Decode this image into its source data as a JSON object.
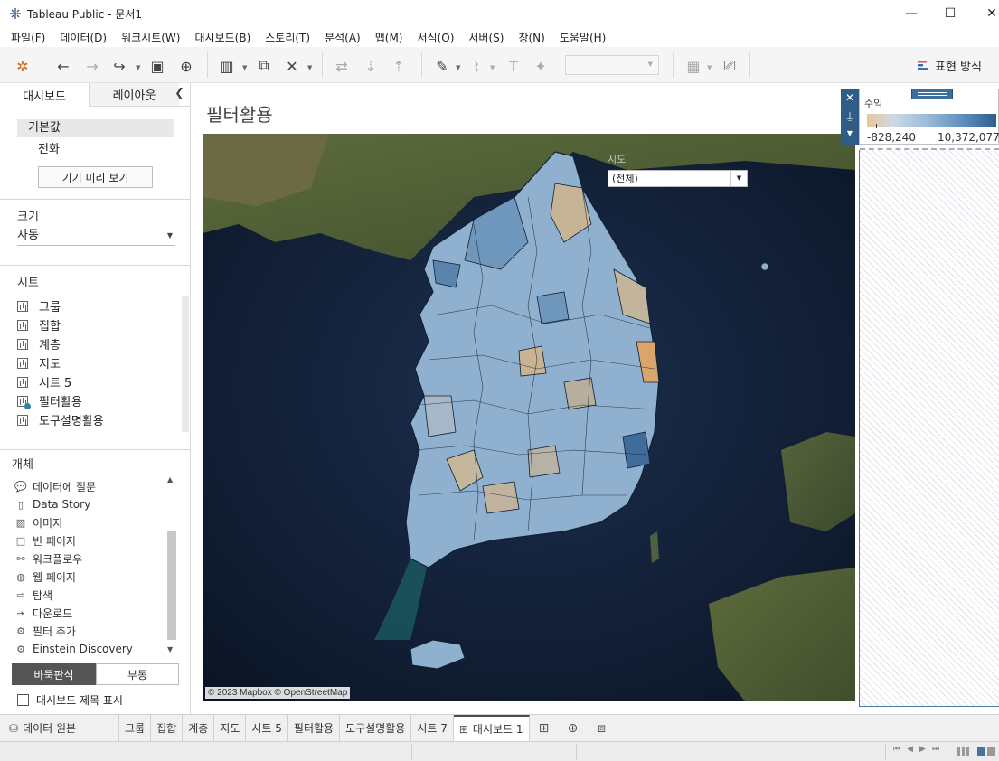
{
  "window": {
    "title": "Tableau Public - 문서1",
    "minimize": "—",
    "maximize": "☐",
    "close": "✕"
  },
  "menu": [
    "파일(F)",
    "데이터(D)",
    "워크시트(W)",
    "대시보드(B)",
    "스토리(T)",
    "분석(A)",
    "맵(M)",
    "서식(O)",
    "서버(S)",
    "창(N)",
    "도움말(H)"
  ],
  "toolbar": {
    "show_me": "표현 방식"
  },
  "left_panel": {
    "tab_dashboard": "대시보드",
    "tab_layout": "레이아웃",
    "device_default": "기본값",
    "device_phone": "전화",
    "preview_button": "기기 미리 보기",
    "size_heading": "크기",
    "size_value": "자동",
    "sheets_heading": "시트",
    "sheets": [
      "그룹",
      "집합",
      "계층",
      "지도",
      "시트 5",
      "필터활용",
      "도구설명활용"
    ],
    "objects_heading": "개체",
    "objects": [
      {
        "label": "데이터에 질문",
        "icon": "ask-data-icon"
      },
      {
        "label": "Data Story",
        "icon": "data-story-icon"
      },
      {
        "label": "이미지",
        "icon": "image-icon"
      },
      {
        "label": "빈 페이지",
        "icon": "blank-icon"
      },
      {
        "label": "워크플로우",
        "icon": "workflow-icon"
      },
      {
        "label": "웹 페이지",
        "icon": "globe-icon"
      },
      {
        "label": "탐색",
        "icon": "navigation-icon"
      },
      {
        "label": "다운로드",
        "icon": "download-icon"
      },
      {
        "label": "필터 추가",
        "icon": "extension-icon"
      },
      {
        "label": "Einstein Discovery",
        "icon": "extension-icon"
      }
    ],
    "tiled": "바둑판식",
    "floating": "부동",
    "show_title": "대시보드 제목 표시"
  },
  "dashboard": {
    "title": "필터활용",
    "filter_label": "시도",
    "filter_value": "(전체)",
    "attribution": "© 2023 Mapbox © OpenStreetMap"
  },
  "legend": {
    "title": "수익",
    "min": "-828,240",
    "max": "10,372,077"
  },
  "tabs": {
    "datasource": "데이터 원본",
    "sheets": [
      "그룹",
      "집합",
      "계층",
      "지도",
      "시트 5",
      "필터활용",
      "도구설명활용",
      "시트 7"
    ],
    "active": "대시보드 1"
  }
}
